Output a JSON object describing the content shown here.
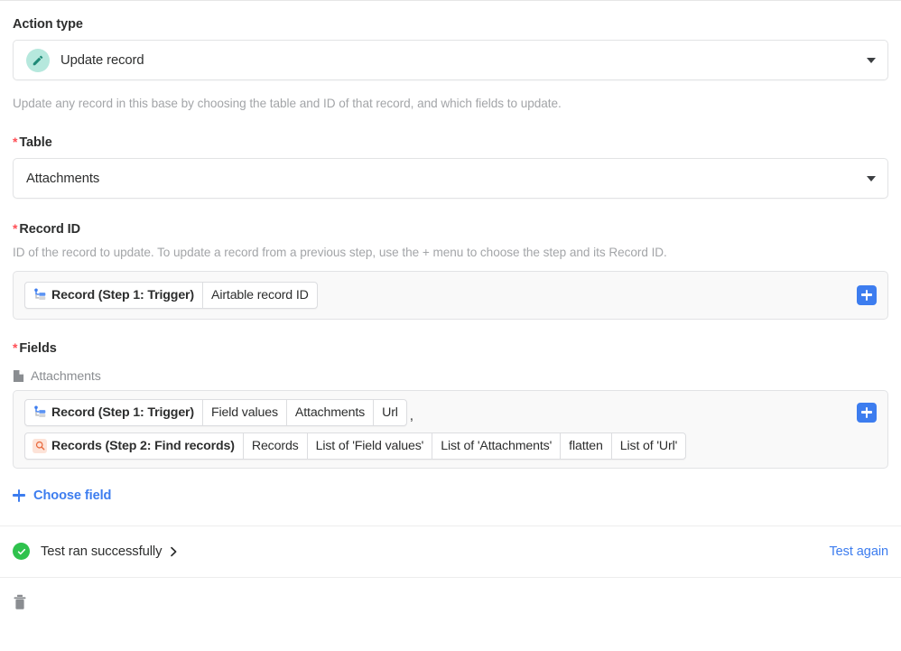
{
  "action_type": {
    "label": "Action type",
    "selected": "Update record",
    "icon": "pencil-icon",
    "icon_bg": "#b6e8dd",
    "description": "Update any record in this base by choosing the table and ID of that record, and which fields to update."
  },
  "table": {
    "label": "Table",
    "required_marker": "*",
    "selected": "Attachments"
  },
  "record_id": {
    "label": "Record ID",
    "required_marker": "*",
    "description": "ID of the record to update. To update a record from a previous step, use the + menu to choose the step and its Record ID.",
    "tokens": [
      {
        "icon": "workflow-trigger-icon",
        "segments": [
          "Record (Step 1: Trigger)",
          "Airtable record ID"
        ]
      }
    ],
    "add_button": "plus-icon"
  },
  "fields": {
    "label": "Fields",
    "required_marker": "*",
    "subfield": {
      "icon": "document-icon",
      "label": "Attachments"
    },
    "tokens": [
      {
        "icon": "workflow-trigger-icon",
        "segments": [
          "Record (Step 1: Trigger)",
          "Field values",
          "Attachments",
          "Url"
        ],
        "trailing": ","
      },
      {
        "icon": "search-icon",
        "segments": [
          "Records (Step 2: Find records)",
          "Records",
          "List of 'Field values'",
          "List of 'Attachments'",
          "flatten",
          "List of 'Url'"
        ],
        "trailing": ""
      }
    ],
    "add_button": "plus-icon",
    "choose_field_label": "Choose field"
  },
  "status": {
    "icon": "success-check-icon",
    "icon_color": "#2fc24d",
    "text": "Test ran successfully",
    "chevron": "chevron-right-icon",
    "test_again_label": "Test again"
  },
  "footer": {
    "delete_icon": "trash-icon"
  },
  "colors": {
    "accent_blue": "#3d7def",
    "required_red": "#ff4f56",
    "success_green": "#2fc24d",
    "search_chip_bg": "#fde3d8",
    "action_icon_bg": "#b6e8dd"
  }
}
